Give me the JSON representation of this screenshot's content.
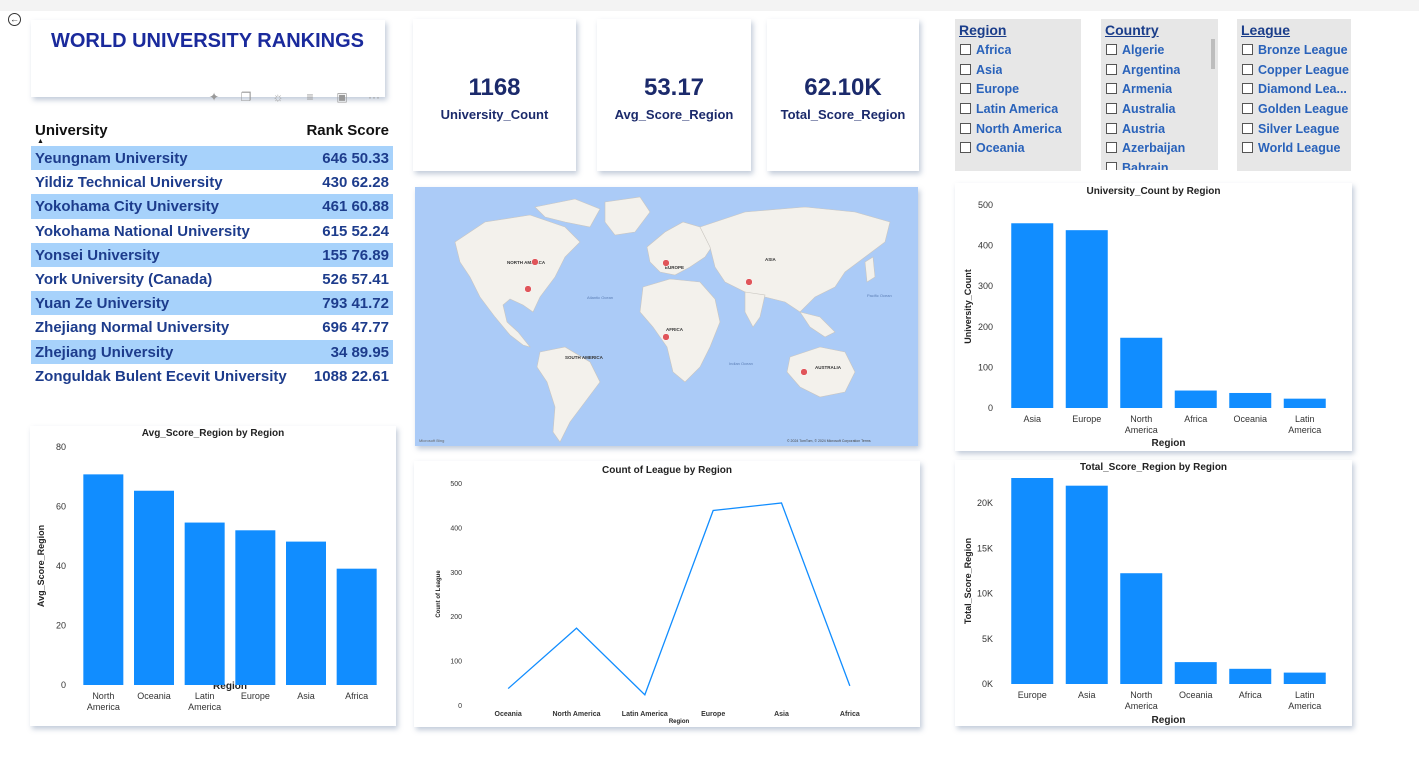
{
  "title": "WORLD UNIVERSITY RANKINGS",
  "kpis": [
    {
      "value": "1168",
      "label": "University_Count"
    },
    {
      "value": "53.17",
      "label": "Avg_Score_Region"
    },
    {
      "value": "62.10K",
      "label": "Total_Score_Region"
    }
  ],
  "table": {
    "col_university": "University",
    "col_rank_score": "Rank Score",
    "rows": [
      {
        "name": "Yeungnam University",
        "rank_score": "646 50.33"
      },
      {
        "name": "Yildiz Technical University",
        "rank_score": "430 62.28"
      },
      {
        "name": "Yokohama City University",
        "rank_score": "461 60.88"
      },
      {
        "name": "Yokohama National University",
        "rank_score": "615 52.24"
      },
      {
        "name": "Yonsei University",
        "rank_score": "155 76.89"
      },
      {
        "name": "York University (Canada)",
        "rank_score": "526 57.41"
      },
      {
        "name": "Yuan Ze University",
        "rank_score": "793 41.72"
      },
      {
        "name": "Zhejiang Normal University",
        "rank_score": "696 47.77"
      },
      {
        "name": "Zhejiang University",
        "rank_score": "34 89.95"
      },
      {
        "name": "Zonguldak Bulent Ecevit University",
        "rank_score": "1088 22.61"
      }
    ]
  },
  "slicers": {
    "region": {
      "title": "Region",
      "items": [
        "Africa",
        "Asia",
        "Europe",
        "Latin America",
        "North America",
        "Oceania"
      ]
    },
    "country": {
      "title": "Country",
      "items": [
        "Algerie",
        "Argentina",
        "Armenia",
        "Australia",
        "Austria",
        "Azerbaijan",
        "Bahrain"
      ]
    },
    "league": {
      "title": "League",
      "items": [
        "Bronze League",
        "Copper League",
        "Diamond Lea...",
        "Golden League",
        "Silver League",
        "World League"
      ]
    }
  },
  "map": {
    "labels": [
      "NORTH AMERICA",
      "EUROPE",
      "ASIA",
      "AFRICA",
      "SOUTH AMERICA",
      "AUSTRALIA",
      "Atlantic Ocean",
      "Indian Ocean",
      "Pacific Ocean"
    ],
    "attribution": "© 2024 TomTom, © 2024 Microsoft Corporation  Terms",
    "brand": "Microsoft Bing"
  },
  "chart_data": [
    {
      "id": "avg",
      "type": "bar",
      "title": "Avg_Score_Region by Region",
      "xlabel": "Region",
      "ylabel": "Avg_Score_Region",
      "categories": [
        "North America",
        "Oceania",
        "Latin America",
        "Europe",
        "Asia",
        "Africa"
      ],
      "values": [
        70.8,
        65.3,
        54.6,
        52.0,
        48.2,
        39.1
      ],
      "ylim": [
        0,
        80
      ],
      "yticks": [
        "0",
        "20",
        "40",
        "60",
        "80"
      ],
      "color": "#118dff"
    },
    {
      "id": "league",
      "type": "line",
      "title": "Count of League by Region",
      "xlabel": "Region",
      "ylabel": "Count of League",
      "categories": [
        "Oceania",
        "North America",
        "Latin America",
        "Europe",
        "Asia",
        "Africa"
      ],
      "values": [
        37,
        173,
        23,
        438,
        455,
        43
      ],
      "ylim": [
        0,
        500
      ],
      "yticks": [
        "0",
        "100",
        "200",
        "300",
        "400",
        "500"
      ],
      "color": "#118dff"
    },
    {
      "id": "count",
      "type": "bar",
      "title": "University_Count by Region",
      "xlabel": "Region",
      "ylabel": "University_Count",
      "categories": [
        "Asia",
        "Europe",
        "North America",
        "Africa",
        "Oceania",
        "Latin America"
      ],
      "values": [
        455,
        438,
        173,
        43,
        37,
        23
      ],
      "ylim": [
        0,
        500
      ],
      "yticks": [
        "0",
        "100",
        "200",
        "300",
        "400",
        "500"
      ],
      "color": "#118dff"
    },
    {
      "id": "total",
      "type": "bar",
      "title": "Total_Score_Region by Region",
      "xlabel": "Region",
      "ylabel": "Total_Score_Region",
      "categories": [
        "Europe",
        "Asia",
        "North America",
        "Oceania",
        "Africa",
        "Latin America"
      ],
      "values": [
        22780,
        21930,
        12250,
        2420,
        1680,
        1260
      ],
      "ylim": [
        0,
        22780
      ],
      "yticks": [
        "0K",
        "5K",
        "10K",
        "15K",
        "20K"
      ],
      "ytick_values": [
        0,
        5000,
        10000,
        15000,
        20000
      ],
      "color": "#118dff"
    }
  ]
}
